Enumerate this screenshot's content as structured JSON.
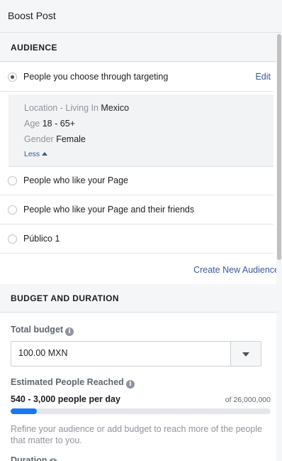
{
  "header": {
    "title": "Boost Post"
  },
  "audience": {
    "heading": "AUDIENCE",
    "selected_option": {
      "label": "People you choose through targeting",
      "edit_label": "Edit",
      "targeting": {
        "location_key": "Location - Living In",
        "location_value": "Mexico",
        "age_key": "Age",
        "age_value": "18 - 65+",
        "gender_key": "Gender",
        "gender_value": "Female",
        "less_label": "Less"
      }
    },
    "options": [
      {
        "label": "People who like your Page"
      },
      {
        "label": "People who like your Page and their friends"
      },
      {
        "label": "Público 1"
      }
    ],
    "create_label": "Create New Audience"
  },
  "budget": {
    "heading": "BUDGET AND DURATION",
    "total_label": "Total budget",
    "total_value": "100.00 MXN",
    "reach_label": "Estimated People Reached",
    "reach_range": "540 - 3,000 people per day",
    "reach_total": "of 26,000,000",
    "reach_progress_percent": 10,
    "note": "Refine your audience or add budget to reach more of the people that matter to you.",
    "duration_label": "Duration"
  },
  "icons": {
    "info": "info-icon",
    "dropdown": "chevron-down-icon",
    "collapse": "caret-up-icon"
  },
  "colors": {
    "link": "#385898",
    "progress": "#1877f2"
  }
}
